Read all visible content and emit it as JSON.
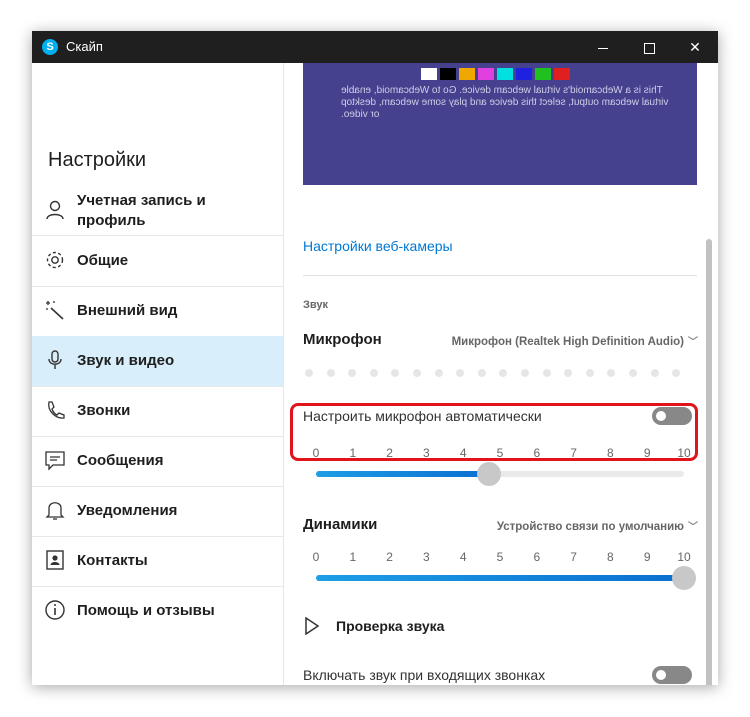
{
  "window": {
    "title": "Скайп",
    "app_icon_letter": "S"
  },
  "sidebar": {
    "heading": "Настройки",
    "items": [
      {
        "label": "Учетная запись и профиль",
        "icon": "person-icon",
        "active": false
      },
      {
        "label": "Общие",
        "icon": "gear-icon",
        "active": false
      },
      {
        "label": "Внешний вид",
        "icon": "magic-wand-icon",
        "active": false
      },
      {
        "label": "Звук и видео",
        "icon": "microphone-icon",
        "active": true
      },
      {
        "label": "Звонки",
        "icon": "phone-icon",
        "active": false
      },
      {
        "label": "Сообщения",
        "icon": "chat-icon",
        "active": false
      },
      {
        "label": "Уведомления",
        "icon": "bell-icon",
        "active": false
      },
      {
        "label": "Контакты",
        "icon": "contacts-icon",
        "active": false
      },
      {
        "label": "Помощь и отзывы",
        "icon": "info-icon",
        "active": false
      }
    ]
  },
  "webcam": {
    "preview_text": "This is a Webcamoid's virtual webcam device. Go to Webcamoid, enable virtual webcam output, select this device and play some webcam, desktop or video.",
    "swatch_colors": [
      "#ffffff",
      "#000000",
      "#f0a800",
      "#e040e0",
      "#00e0e0",
      "#2020e0",
      "#20c020",
      "#e02020"
    ],
    "settings_link": "Настройки веб-камеры"
  },
  "audio": {
    "section_label": "Звук",
    "microphone": {
      "title": "Микрофон",
      "device": "Микрофон (Realtek High Definition Audio)",
      "auto_adjust_label": "Настроить микрофон автоматически",
      "auto_adjust_on": false,
      "volume": 4.7,
      "scale": [
        "0",
        "1",
        "2",
        "3",
        "4",
        "5",
        "6",
        "7",
        "8",
        "9",
        "10"
      ]
    },
    "speakers": {
      "title": "Динамики",
      "device": "Устройство связи по умолчанию",
      "volume": 10,
      "scale": [
        "0",
        "1",
        "2",
        "3",
        "4",
        "5",
        "6",
        "7",
        "8",
        "9",
        "10"
      ]
    },
    "test_sound_label": "Проверка звука",
    "incoming_ring_label": "Включать звук при входящих звонках",
    "incoming_ring_on": false
  },
  "colors": {
    "accent": "#0078d4",
    "active_nav": "#d9eefb",
    "highlight": "#e0141c",
    "titlebar": "#1f1f1f"
  }
}
